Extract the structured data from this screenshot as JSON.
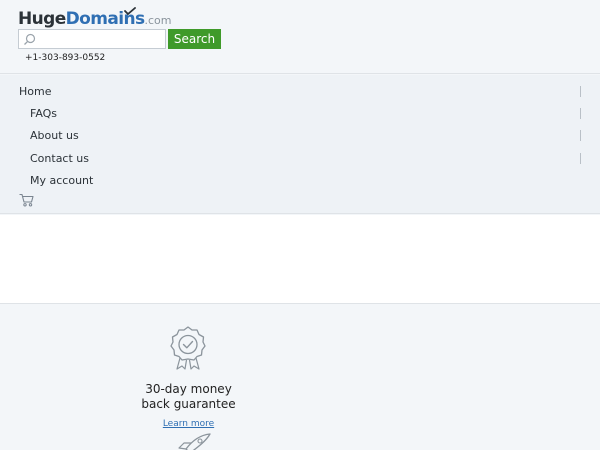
{
  "header": {
    "logo": {
      "part1": "Huge",
      "part2": "Domains",
      "part3": ".com"
    },
    "search": {
      "placeholder": "",
      "value": "",
      "icon": "search-icon",
      "button_label": "Search"
    },
    "phone": "+1-303-893-0552"
  },
  "nav": {
    "items": [
      {
        "label": "Home"
      },
      {
        "label": "FAQs"
      },
      {
        "label": "About us"
      },
      {
        "label": "Contact us"
      },
      {
        "label": "My account"
      }
    ],
    "cart_icon": "cart-icon"
  },
  "feature": {
    "icon": "award-badge-icon",
    "title_line1": "30-day money",
    "title_line2": "back guarantee",
    "link_label": "Learn more",
    "next_icon": "rocket-icon"
  },
  "colors": {
    "brand_dark": "#2b3238",
    "brand_blue": "#2f6fb3",
    "search_button": "#3f9a2a",
    "background": "#f3f6f9",
    "link": "#2f6fb3"
  }
}
